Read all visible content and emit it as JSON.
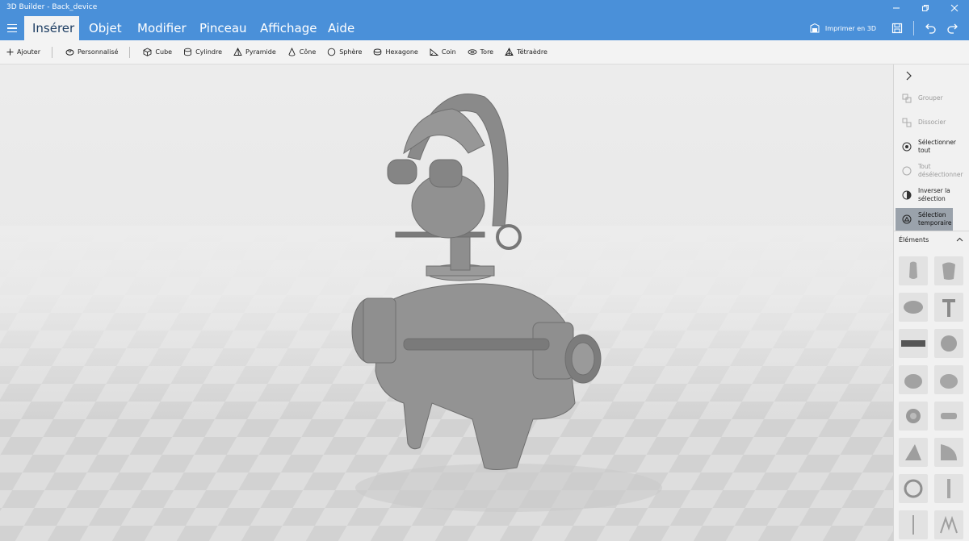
{
  "window": {
    "title": "3D Builder - Back_device"
  },
  "menu": {
    "tabs": [
      {
        "label": "Insérer",
        "active": true
      },
      {
        "label": "Objet",
        "active": false
      },
      {
        "label": "Modifier",
        "active": false
      },
      {
        "label": "Pinceau",
        "active": false
      },
      {
        "label": "Affichage",
        "active": false
      },
      {
        "label": "Aide",
        "active": false
      }
    ],
    "print3d_label": "Imprimer en 3D"
  },
  "toolbar": {
    "add_label": "Ajouter",
    "custom_label": "Personnalisé",
    "shapes": [
      "Cube",
      "Cylindre",
      "Pyramide",
      "Cône",
      "Sphère",
      "Hexagone",
      "Coin",
      "Tore",
      "Tétraèdre"
    ]
  },
  "panel": {
    "items": [
      {
        "label": "Grouper",
        "state": "disabled"
      },
      {
        "label": "Dissocier",
        "state": "disabled"
      },
      {
        "label": "Sélectionner tout",
        "state": "enabled"
      },
      {
        "label": "Tout désélectionner",
        "state": "disabled"
      },
      {
        "label": "Inverser la sélection",
        "state": "enabled"
      },
      {
        "label": "Sélection temporaire",
        "state": "active"
      }
    ],
    "elements_label": "Éléments"
  },
  "colors": {
    "accent": "#4a90d9",
    "active_tab_text": "#1e3e63",
    "model_grey": "#8c8c8c"
  }
}
